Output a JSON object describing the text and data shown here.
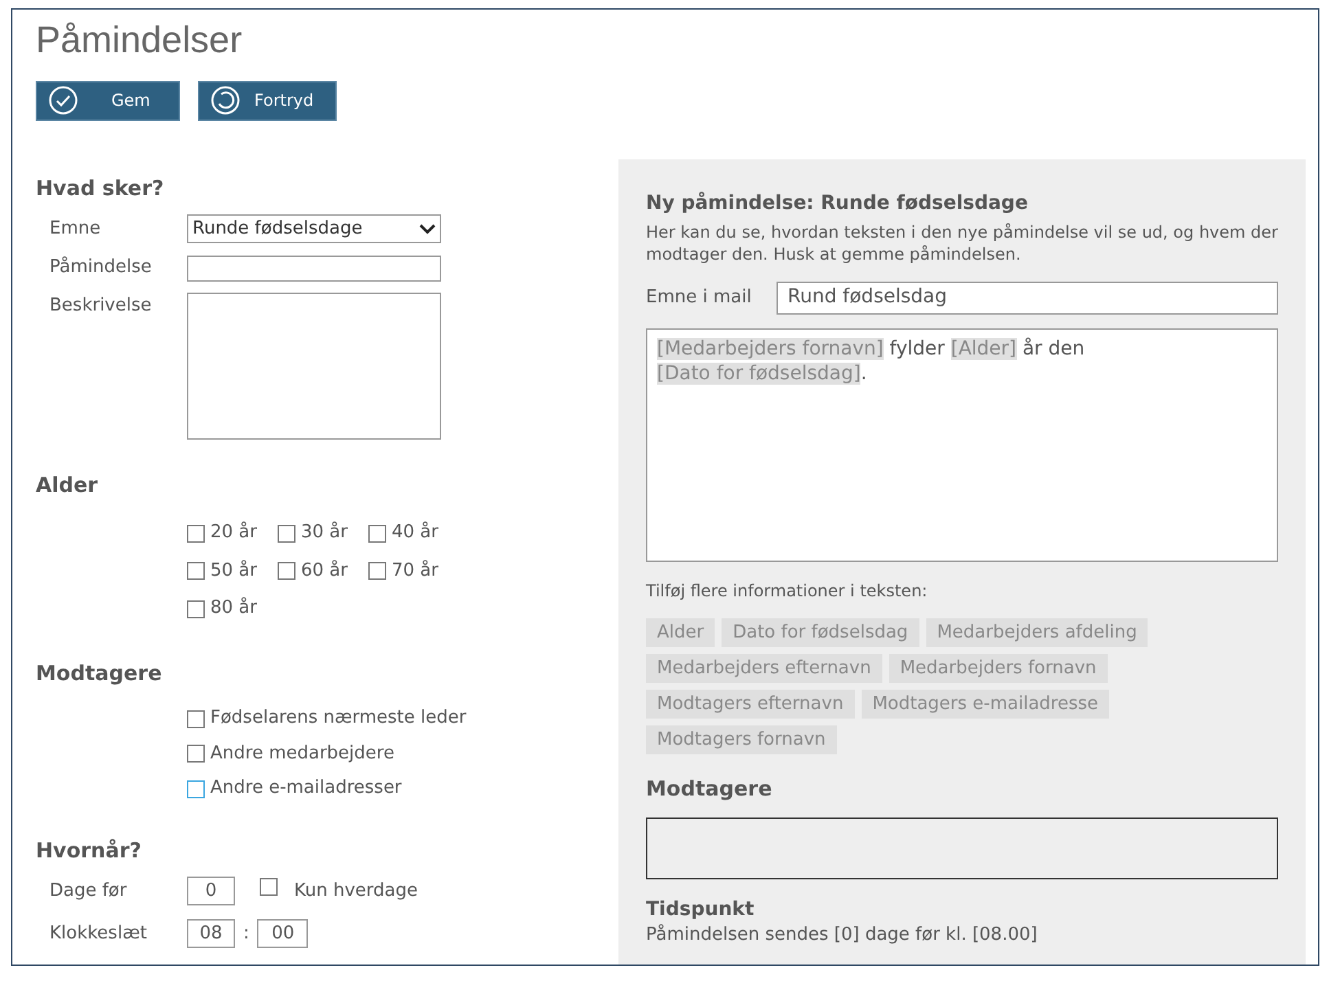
{
  "title": "Påmindelser",
  "buttons": [
    {
      "kind": "save",
      "label": "Gem"
    },
    {
      "kind": "undo",
      "label": "Fortryd"
    }
  ],
  "what": {
    "heading": "Hvad sker?",
    "subject_label": "Emne",
    "subject_value": "Runde fødselsdage",
    "reminder_label": "Påmindelse",
    "description_label": "Beskrivelse"
  },
  "age": {
    "heading": "Alder",
    "options": [
      {
        "label": "20 år",
        "checked": false
      },
      {
        "label": "30 år",
        "checked": false
      },
      {
        "label": "40 år",
        "checked": false
      },
      {
        "label": "50 år",
        "checked": false
      },
      {
        "label": "60 år",
        "checked": false
      },
      {
        "label": "70 år",
        "checked": false
      },
      {
        "label": "80 år",
        "checked": false
      }
    ]
  },
  "recipients": {
    "heading": "Modtagere",
    "options": [
      {
        "label": "Fødselarens nærmeste leder",
        "checked": false,
        "color": "#777777"
      },
      {
        "label": "Andre medarbejdere",
        "checked": false,
        "color": "#777777"
      },
      {
        "label": "Andre e-mailadresser",
        "checked": false,
        "color": "#3aa6e0"
      }
    ]
  },
  "when": {
    "heading": "Hvornår?",
    "days_label": "Dage før",
    "days_value": "0",
    "weekdays_label": "Kun hverdage",
    "weekdays_checked": false,
    "time_label": "Klokkeslæt",
    "hour": "08",
    "separator": ":",
    "minute": "00"
  },
  "preview": {
    "title": "Ny påmindelse: Runde fødselsdage",
    "intro": "Her kan du se, hvordan teksten i den nye påmindelse vil se ud, og hvem der modtager den. Husk at gemme påmindelsen.",
    "mail_subject_label": "Emne i mail",
    "mail_subject_value": "Rund fødselsdag",
    "body_lines": [
      [
        {
          "kind": "token",
          "text": "[Medarbejders fornavn]"
        },
        {
          "kind": "text",
          "text": " fylder "
        },
        {
          "kind": "token",
          "text": "[Alder]"
        },
        {
          "kind": "text",
          "text": " år den"
        }
      ],
      [
        {
          "kind": "token",
          "text": "[Dato for fødselsdag]"
        },
        {
          "kind": "text",
          "text": "."
        }
      ]
    ],
    "add_label": "Tilføj flere informationer i teksten:",
    "tokens": [
      "Alder",
      "Dato for fødselsdag",
      "Medarbejders afdeling",
      "Medarbejders efternavn",
      "Medarbejders fornavn",
      "Modtagers efternavn",
      "Modtagers e-mailadresse",
      "Modtagers fornavn"
    ],
    "recipients_heading": "Modtagere",
    "time_heading": "Tidspunkt",
    "time_text": "Påmindelsen sendes [0] dage før kl. [08.00]"
  }
}
